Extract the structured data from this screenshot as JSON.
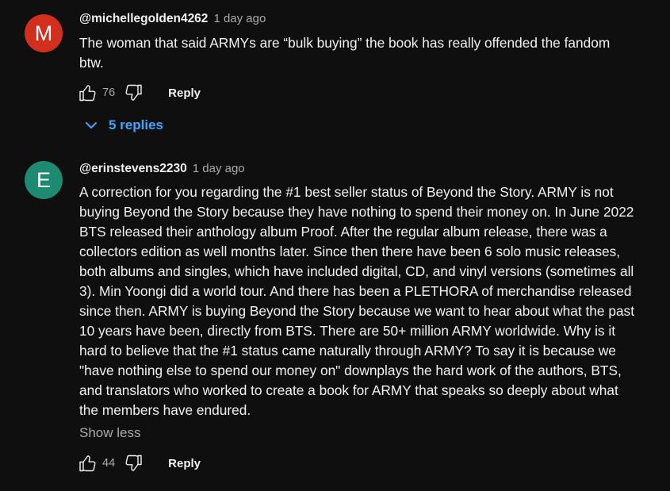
{
  "comments": [
    {
      "avatar_letter": "M",
      "avatar_color": "#d32f1f",
      "author": "@michellegolden4262",
      "time": "1 day ago",
      "body_lines": [
        "The woman that said ARMYs are “bulk buying” the book has really offended the fandom",
        "btw."
      ],
      "likes": "76",
      "reply_label": "Reply",
      "replies_label": "5 replies"
    },
    {
      "avatar_letter": "E",
      "avatar_color": "#1e8a72",
      "author": "@erinstevens2230",
      "time": "1 day ago",
      "body_lines": [
        "A correction for you regarding the #1 best seller status of Beyond the Story. ARMY is not",
        "buying Beyond the Story because they have nothing to spend their money on. In June 2022",
        "BTS released their anthology album Proof. After the regular album release,  there was a",
        "collectors edition as well months later. Since then there have been 6 solo music releases,",
        "both albums and singles, which have included digital, CD, and vinyl versions (sometimes all",
        "3). Min Yoongi did a world tour. And there has been a PLETHORA of merchandise released",
        "since then. ARMY is buying Beyond the Story because we want to hear about what the past",
        "10 years have been, directly from BTS. There are 50+ million ARMY worldwide. Why is it",
        "hard to believe that the #1 status came naturally through ARMY? To say it is because we",
        "\"have nothing else to spend our money on\" downplays the hard work of the authors, BTS,",
        "and translators who worked to create a book for ARMY that speaks so deeply about what",
        "the members have endured."
      ],
      "show_less_label": "Show less",
      "likes": "44",
      "reply_label": "Reply"
    }
  ],
  "colors": {
    "background": "#0f0f0f",
    "text_primary": "#f1f1f1",
    "text_secondary": "#aaaaaa",
    "link_blue": "#3ea6ff"
  }
}
